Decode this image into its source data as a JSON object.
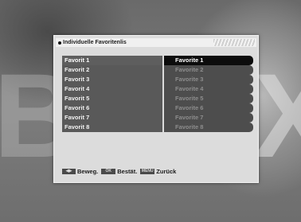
{
  "background": {
    "letters": [
      "B",
      "X"
    ]
  },
  "menu": {
    "title": "Individuelle Favoritenlis",
    "items": [
      {
        "label": "Favorit  1",
        "value": "Favorite 1",
        "selected": true
      },
      {
        "label": "Favorit  2",
        "value": "Favorite 2",
        "selected": false
      },
      {
        "label": "Favorit  3",
        "value": "Favorite 3",
        "selected": false
      },
      {
        "label": "Favorit  4",
        "value": "Favorite 4",
        "selected": false
      },
      {
        "label": "Favorit  5",
        "value": "Favorite 5",
        "selected": false
      },
      {
        "label": "Favorit  6",
        "value": "Favorite 6",
        "selected": false
      },
      {
        "label": "Favorit  7",
        "value": "Favorite 7",
        "selected": false
      },
      {
        "label": "Favorit  8",
        "value": "Favorite 8",
        "selected": false
      }
    ]
  },
  "footer": {
    "move_key": "◀▶",
    "move_label": "Beweg.",
    "confirm_key": "OK",
    "confirm_label": "Bestät.",
    "back_key": "MENU",
    "back_label": "Zurück"
  },
  "colors": {
    "panel": "#dcdcdc",
    "row_label": "#595959",
    "row_value": "#4d4d4d",
    "selected_value": "#0c0c0c"
  }
}
